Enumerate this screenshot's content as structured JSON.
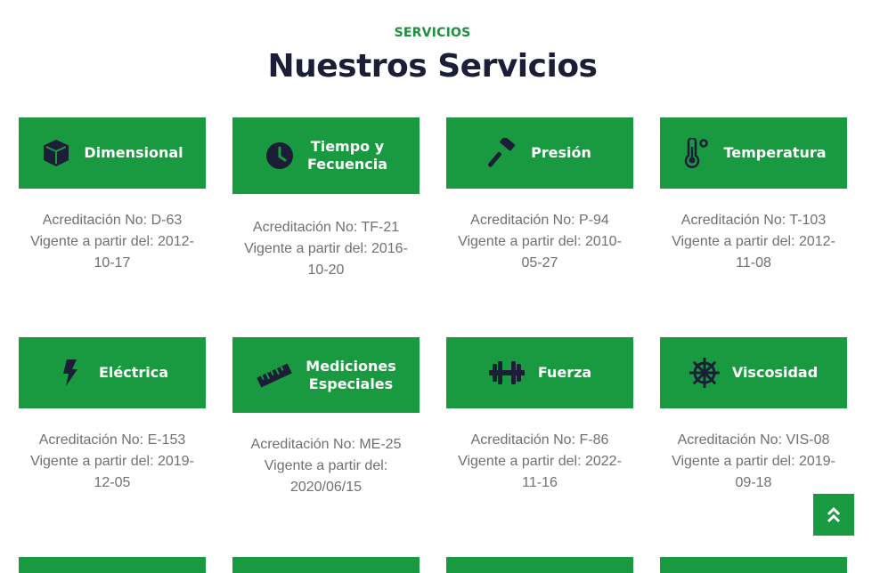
{
  "section": {
    "eyebrow": "SERVICIOS",
    "title": "Nuestros Servicios"
  },
  "cards": [
    {
      "icon": "cube-icon",
      "label_lines": [
        "Dimensional"
      ],
      "accreditation": "Acreditación No: D-63",
      "valid_lines": [
        "Vigente a partir del: 2012-",
        "10-17"
      ]
    },
    {
      "icon": "clock-icon",
      "label_lines": [
        "Tiempo y",
        "Fecuencia"
      ],
      "accreditation": "Acreditación No: TF-21",
      "valid_lines": [
        "Vigente a partir del: 2016-",
        "10-20"
      ]
    },
    {
      "icon": "hammer-icon",
      "label_lines": [
        "Presión"
      ],
      "accreditation": "Acreditación No: P-94",
      "valid_lines": [
        "Vigente a partir del: 2010-",
        "05-27"
      ]
    },
    {
      "icon": "thermometer-icon",
      "label_lines": [
        "Temperatura"
      ],
      "accreditation": "Acreditación No: T-103",
      "valid_lines": [
        "Vigente a partir del: 2012-",
        "11-08"
      ]
    },
    {
      "icon": "bolt-icon",
      "label_lines": [
        "Eléctrica"
      ],
      "accreditation": "Acreditación No: E-153",
      "valid_lines": [
        "Vigente a partir del: 2019-",
        "12-05"
      ]
    },
    {
      "icon": "ruler-icon",
      "label_lines": [
        "Mediciones",
        "Especiales"
      ],
      "accreditation": "Acreditación No: ME-25",
      "valid_lines": [
        "Vigente a partir del:",
        "2020/06/15"
      ]
    },
    {
      "icon": "dumbbell-icon",
      "label_lines": [
        "Fuerza"
      ],
      "accreditation": "Acreditación No: F-86",
      "valid_lines": [
        "Vigente a partir del: 2022-",
        "11-16"
      ]
    },
    {
      "icon": "dharma-wheel-icon",
      "label_lines": [
        "Viscosidad"
      ],
      "accreditation": "Acreditación No: VIS-08",
      "valid_lines": [
        "Vigente a partir del: 2019-",
        "09-18"
      ]
    }
  ],
  "colors": {
    "accent": "#1a9a40",
    "eyebrow": "#1e8f3e",
    "title": "#1c1d36",
    "body_text": "#707070",
    "icon": "#1c1d36"
  },
  "scroll_top": {
    "icon": "double-chevron-up-icon"
  }
}
